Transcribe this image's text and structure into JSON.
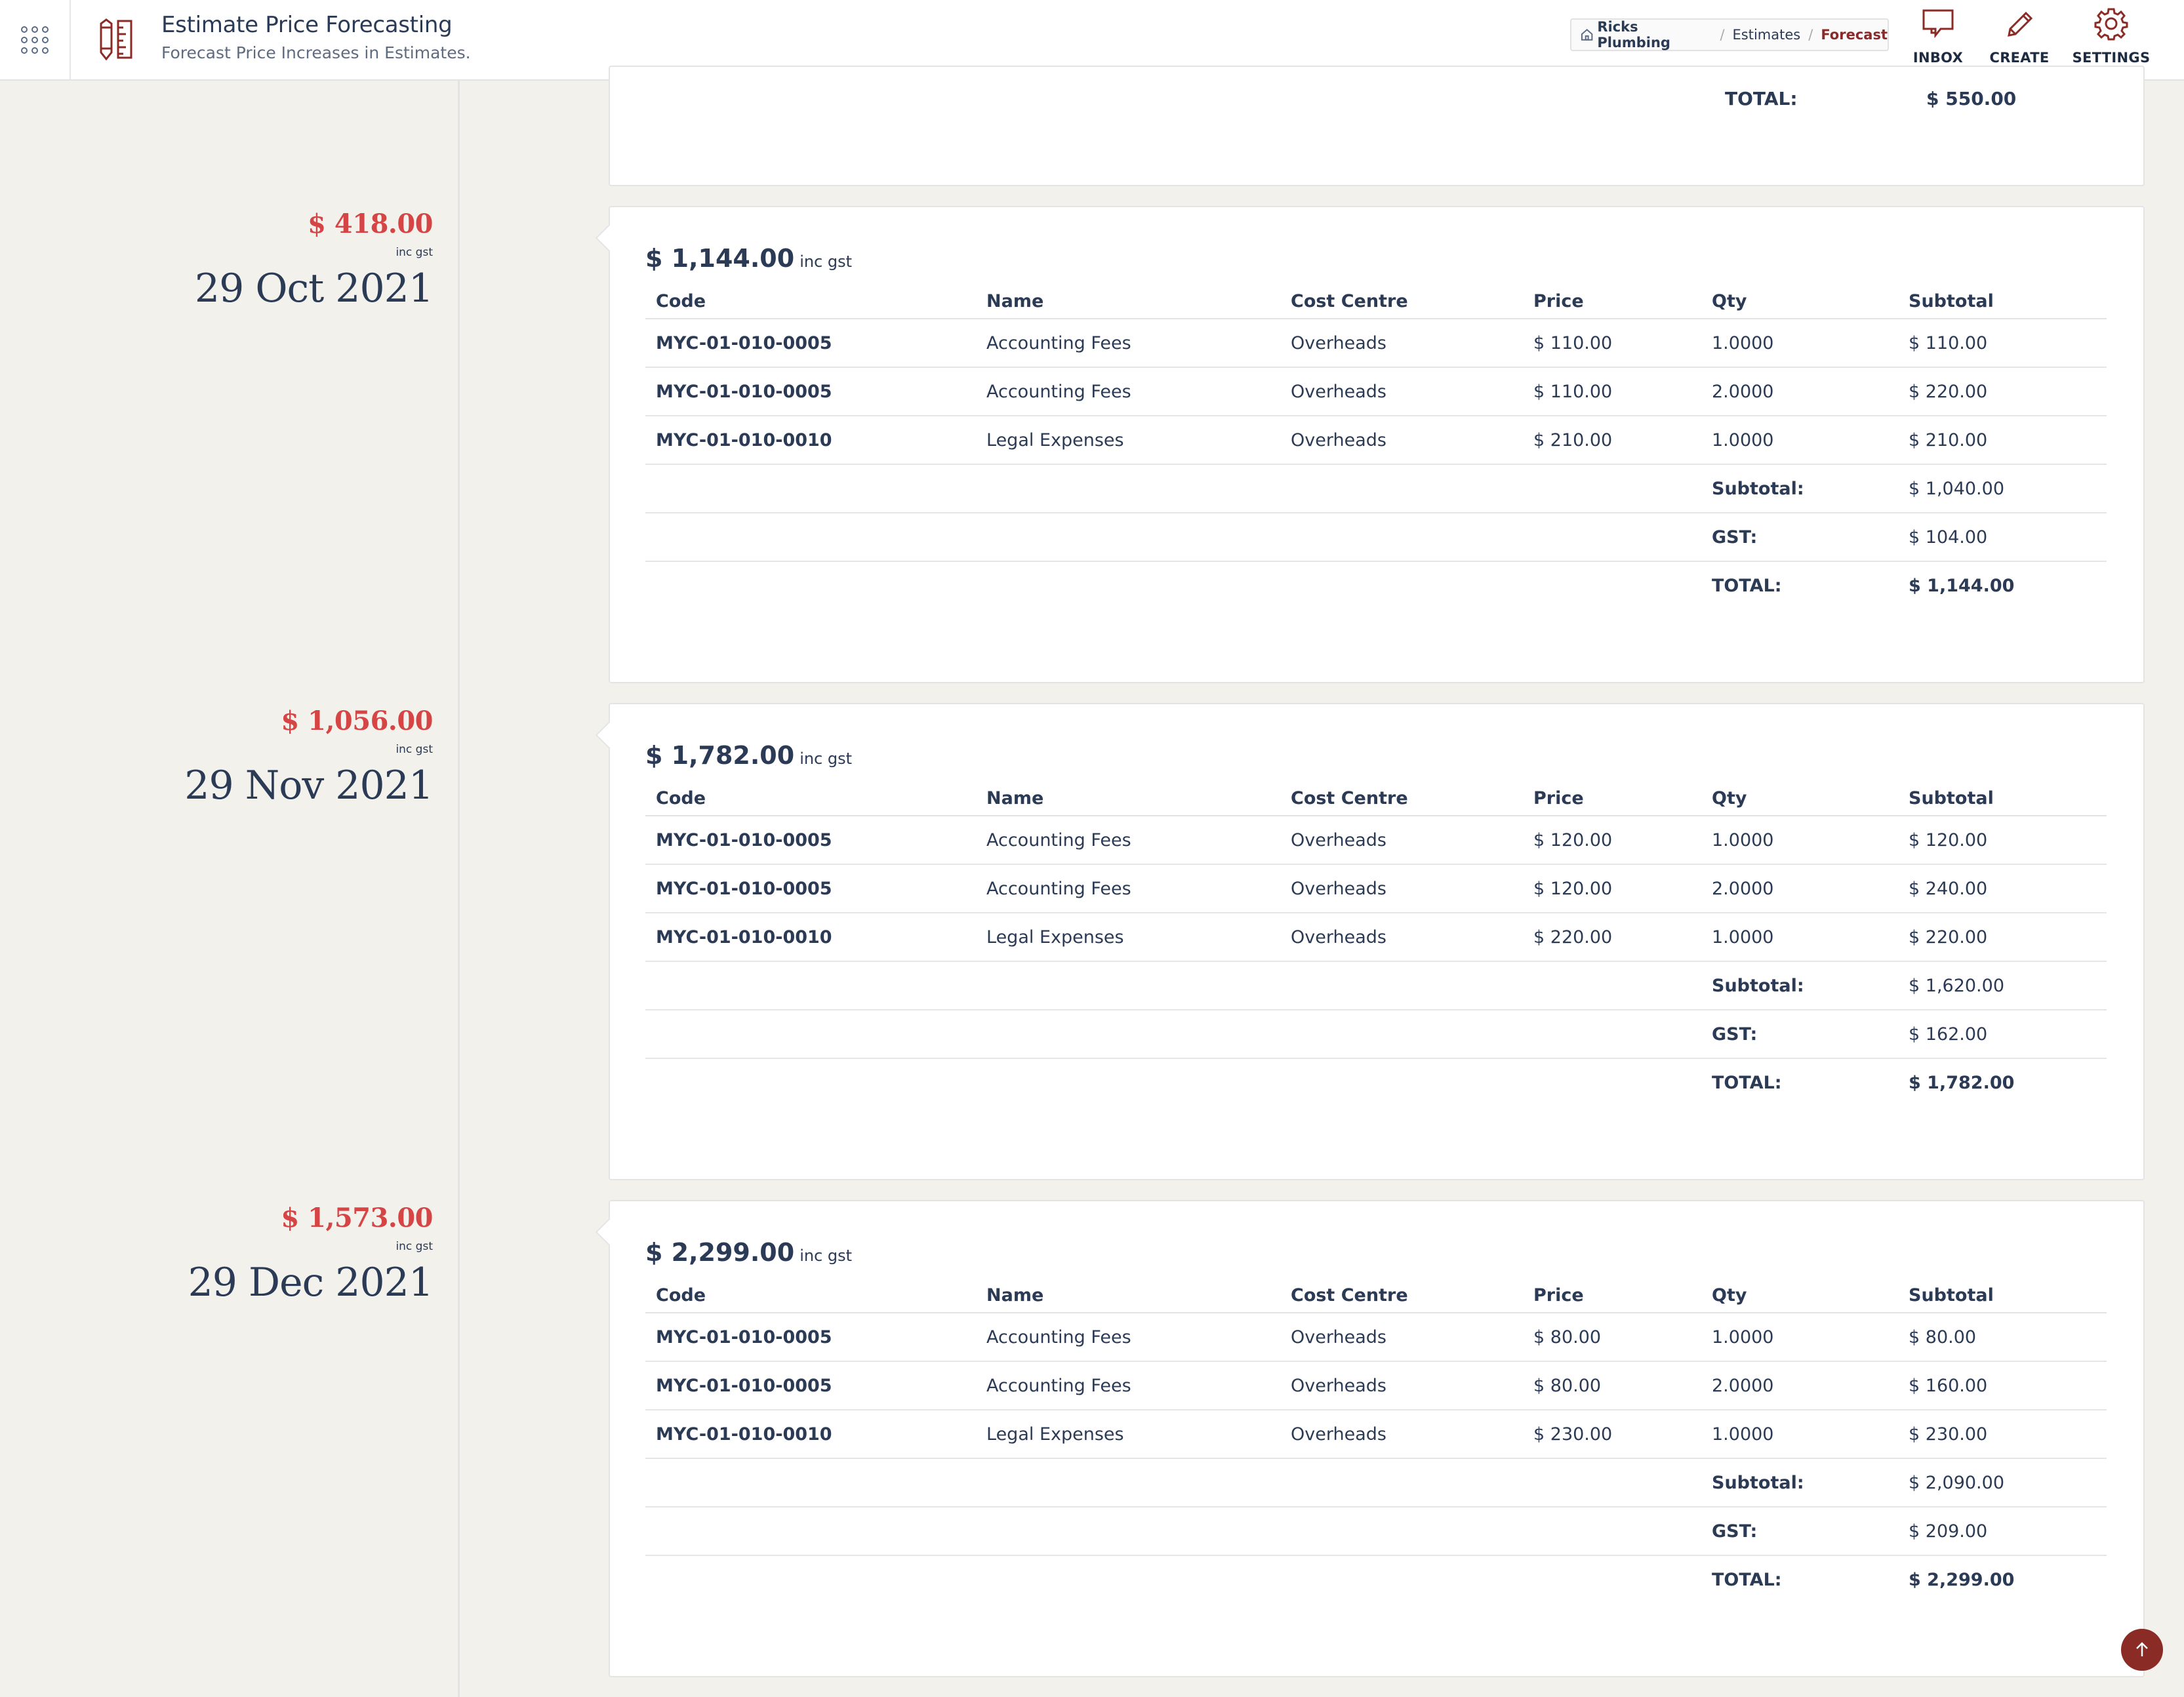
{
  "header": {
    "title": "Estimate Price Forecasting",
    "subtitle": "Forecast Price Increases in Estimates.",
    "apps_icon": "apps-grid-icon",
    "module_icon": "pencil-ruler-icon"
  },
  "breadcrumb": {
    "home": "Ricks Plumbing",
    "items": [
      "Estimates",
      "Forecast"
    ]
  },
  "actions": {
    "inbox": "INBOX",
    "create": "CREATE",
    "settings": "SETTINGS"
  },
  "top_card": {
    "total_label": "TOTAL:",
    "total_value": "$ 550.00"
  },
  "columns": {
    "code": "Code",
    "name": "Name",
    "cost_centre": "Cost Centre",
    "price": "Price",
    "qty": "Qty",
    "subtotal": "Subtotal"
  },
  "summary_labels": {
    "subtotal": "Subtotal:",
    "gst": "GST:",
    "total": "TOTAL:"
  },
  "entries": [
    {
      "increase": "$ 418.00",
      "inc_gst": "inc gst",
      "date": "29 Oct 2021",
      "card_total": "$ 1,144.00",
      "card_inc_gst": "inc gst",
      "rows": [
        {
          "code": "MYC-01-010-0005",
          "name": "Accounting Fees",
          "cost_centre": "Overheads",
          "price": "$ 110.00",
          "qty": "1.0000",
          "subtotal": "$ 110.00"
        },
        {
          "code": "MYC-01-010-0005",
          "name": "Accounting Fees",
          "cost_centre": "Overheads",
          "price": "$ 110.00",
          "qty": "2.0000",
          "subtotal": "$ 220.00"
        },
        {
          "code": "MYC-01-010-0010",
          "name": "Legal Expenses",
          "cost_centre": "Overheads",
          "price": "$ 210.00",
          "qty": "1.0000",
          "subtotal": "$ 210.00"
        }
      ],
      "subtotal": "$ 1,040.00",
      "gst": "$ 104.00",
      "total": "$ 1,144.00"
    },
    {
      "increase": "$ 1,056.00",
      "inc_gst": "inc gst",
      "date": "29 Nov 2021",
      "card_total": "$ 1,782.00",
      "card_inc_gst": "inc gst",
      "rows": [
        {
          "code": "MYC-01-010-0005",
          "name": "Accounting Fees",
          "cost_centre": "Overheads",
          "price": "$ 120.00",
          "qty": "1.0000",
          "subtotal": "$ 120.00"
        },
        {
          "code": "MYC-01-010-0005",
          "name": "Accounting Fees",
          "cost_centre": "Overheads",
          "price": "$ 120.00",
          "qty": "2.0000",
          "subtotal": "$ 240.00"
        },
        {
          "code": "MYC-01-010-0010",
          "name": "Legal Expenses",
          "cost_centre": "Overheads",
          "price": "$ 220.00",
          "qty": "1.0000",
          "subtotal": "$ 220.00"
        }
      ],
      "subtotal": "$ 1,620.00",
      "gst": "$ 162.00",
      "total": "$ 1,782.00"
    },
    {
      "increase": "$ 1,573.00",
      "inc_gst": "inc gst",
      "date": "29 Dec 2021",
      "card_total": "$ 2,299.00",
      "card_inc_gst": "inc gst",
      "rows": [
        {
          "code": "MYC-01-010-0005",
          "name": "Accounting Fees",
          "cost_centre": "Overheads",
          "price": "$ 80.00",
          "qty": "1.0000",
          "subtotal": "$ 80.00"
        },
        {
          "code": "MYC-01-010-0005",
          "name": "Accounting Fees",
          "cost_centre": "Overheads",
          "price": "$ 80.00",
          "qty": "2.0000",
          "subtotal": "$ 160.00"
        },
        {
          "code": "MYC-01-010-0010",
          "name": "Legal Expenses",
          "cost_centre": "Overheads",
          "price": "$ 230.00",
          "qty": "1.0000",
          "subtotal": "$ 230.00"
        }
      ],
      "subtotal": "$ 2,090.00",
      "gst": "$ 209.00",
      "total": "$ 2,299.00"
    }
  ],
  "colors": {
    "accent_red": "#d64545",
    "brand_maroon": "#8b2b26",
    "text_navy": "#2b3a55",
    "background": "#f2f1ec"
  },
  "back_to_top_icon": "arrow-up-icon"
}
